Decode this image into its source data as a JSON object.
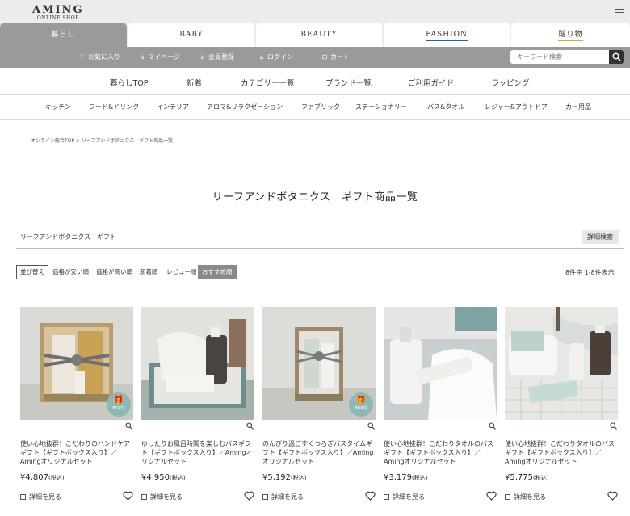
{
  "logo": {
    "name": "AMING",
    "sub": "ONLINE SHOP"
  },
  "tabs": [
    {
      "label": "暮らし",
      "active": true
    },
    {
      "label": "BABY"
    },
    {
      "label": "BEAUTY"
    },
    {
      "label": "FASHION"
    },
    {
      "label": "贈り物"
    }
  ],
  "util": {
    "favorites": "お気に入り",
    "mypage": "マイページ",
    "register": "会員登録",
    "login": "ログイン",
    "cart": "カート",
    "search_placeholder": "キーワード検索"
  },
  "mainnav": [
    "暮らしTOP",
    "新着",
    "カテゴリー一覧",
    "ブランド一覧",
    "ご利用ガイド",
    "ラッピング"
  ],
  "subnav": [
    "キッチン",
    "フード&ドリンク",
    "インテリア",
    "アロマ&リラクゼーション",
    "ファブリック",
    "ステーショナリー",
    "バス&タオル",
    "レジャー&アウトドア",
    "カー用品"
  ],
  "breadcrumb": "オンライン総合TOP > リーフアンドボタニクス　ギフト商品一覧",
  "page_title": "リーフアンドボタニクス　ギフト商品一覧",
  "filter_label": "リーフアンドボタニクス　ギフト",
  "advanced_search": "詳細検索",
  "sort": {
    "label": "並び替え",
    "options": [
      "価格が安い順",
      "価格が高い順",
      "新着順",
      "レビュー順",
      "おすすめ順"
    ],
    "selected": "おすすめ順"
  },
  "result_count": "8件中 1-8件表示",
  "colors": {
    "accent_gray": "#9a9a9a",
    "fashion_underline": "#2a5fa8",
    "gift_underline": "#d6a33c",
    "badge": "#8fb7b4"
  },
  "products": [
    {
      "name": "使い心地抜群！こだわりのハンドケアギフト【ギフトボックス入り】／Amingオリジナルセット",
      "price": "¥4,807",
      "tax": "(税込)",
      "detail": "詳細を見る",
      "badge": "BOX付"
    },
    {
      "name": "ゆったりお風呂時間を楽しむバスギフト【ギフトボックス入り】／Amingオリジナルセット",
      "price": "¥4,950",
      "tax": "(税込)",
      "detail": "詳細を見る"
    },
    {
      "name": "のんびり過ごすくつろぎバスタイムギフト【ギフトボックス入り】／Amingオリジナルセット",
      "price": "¥5,192",
      "tax": "(税込)",
      "detail": "詳細を見る",
      "badge": "BOX付"
    },
    {
      "name": "使い心地抜群！こだわりタオルのバスギフト【ギフトボックス入り】／Amingオリジナルセット",
      "price": "¥3,179",
      "tax": "(税込)",
      "detail": "詳細を見る"
    },
    {
      "name": "使い心地抜群！こだわりタオルのバスギフト【ギフトボックス入り】／Amingオリジナルセット",
      "price": "¥5,775",
      "tax": "(税込)",
      "detail": "詳細を見る"
    }
  ]
}
